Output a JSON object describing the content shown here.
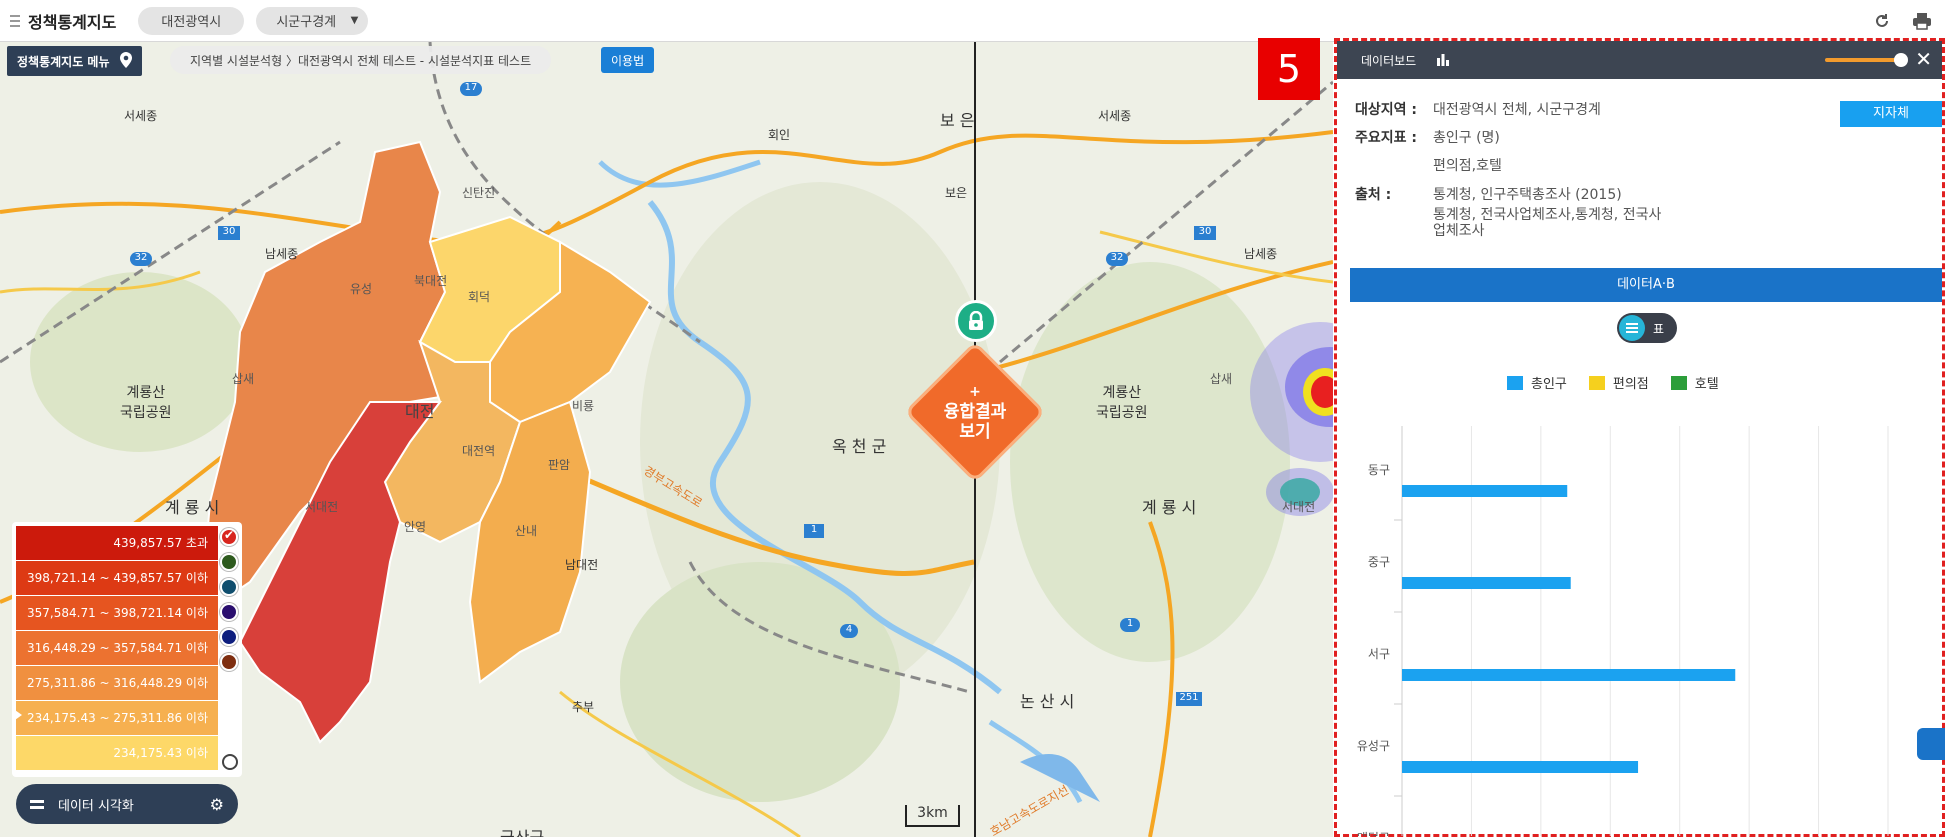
{
  "app": {
    "title": "정책통계지도",
    "region": "대전광역시",
    "boundary": "시군구경계"
  },
  "map": {
    "menu_label": "정책통계지도 메뉴",
    "breadcrumb": "지역별 시설분석형 〉대전광역시 전체 테스트 - 시설분석지표 테스트",
    "usage_label": "이용법",
    "fusion_plus": "+",
    "fusion_label_line1": "융합결과",
    "fusion_label_line2": "보기",
    "scale_label": "3km",
    "labels": {
      "gyeryong": "계룡산\n국립공원",
      "gyeryongsi": "계 룡 시",
      "okcheon": "옥 천 군",
      "nonsan": "논 산 시",
      "daejeon": "대전",
      "hoein": "회인",
      "boeun": "보은",
      "seosejong": "서세종",
      "namsejong": "남세종",
      "sindanjin": "신탄진",
      "yuseong": "유성",
      "nambdaejeon": "남대전",
      "chubu": "추부",
      "seodaejeon": "서대전",
      "bukdaejeon": "북대전",
      "hoedeok": "회덕",
      "biryeong": "비룡",
      "panam": "판암",
      "sannae": "산내",
      "anyeong": "안영",
      "daejeonyeok": "대전역",
      "sapsae": "삽새",
      "gyeongbu": "경부고속도로",
      "honam": "호남고속도로지선",
      "gumsan": "금산군",
      "r17": "17",
      "r30": "30",
      "r32": "32",
      "r1": "1",
      "r4": "4",
      "r251": "251",
      "rboe": "보 은"
    }
  },
  "legend": {
    "rows": [
      {
        "label": "439,857.57 초과",
        "color": "#cc1a0c"
      },
      {
        "label": "398,721.14 ~ 439,857.57 이하",
        "color": "#dd3a14"
      },
      {
        "label": "357,584.71 ~ 398,721.14 이하",
        "color": "#e65520"
      },
      {
        "label": "316,448.29 ~ 357,584.71 이하",
        "color": "#ec7230"
      },
      {
        "label": "275,311.86 ~ 316,448.29 이하",
        "color": "#f09040"
      },
      {
        "label": "234,175.43 ~ 275,311.86 이하",
        "color": "#f6b050"
      },
      {
        "label": "234,175.43 이하",
        "color": "#fdd868"
      }
    ],
    "swatch_colors": [
      "#d8261f",
      "#2d5a1e",
      "#104e6e",
      "#2a0e6e",
      "#0e1e7e",
      "#7e2e10"
    ],
    "viz_label": "데이터 시각화"
  },
  "dashboard": {
    "badge": "5",
    "title": "데이터보드",
    "region_label": "대상지역 :",
    "region_value": "대전광역시 전체, 시군구경계",
    "indicator_label": "주요지표 :",
    "indicator_value1": "총인구 (명)",
    "indicator_value2": "편의점,호텔",
    "source_label": "출처 :",
    "source_value1": "통계청, 인구주택총조사 (2015)",
    "source_value2": "통계청, 전국사업체조사,통계청, 전국사",
    "source_value3": "업체조사",
    "jijache_label": "지자체",
    "ab_label": "데이터A·B",
    "toggle_label": "표"
  },
  "chart_data": {
    "type": "bar",
    "orientation": "horizontal",
    "categories": [
      "동구",
      "중구",
      "서구",
      "유성구",
      "대덕구"
    ],
    "series": [
      {
        "name": "총인구",
        "color": "#1ba2f0",
        "values": [
          238000,
          243000,
          480000,
          340000,
          null
        ]
      },
      {
        "name": "편의점",
        "color": "#f5d01e",
        "values": []
      },
      {
        "name": "호텔",
        "color": "#2c9e3a",
        "values": []
      }
    ],
    "xlim": [
      0,
      700000
    ],
    "grid": true,
    "legend_position": "top"
  }
}
